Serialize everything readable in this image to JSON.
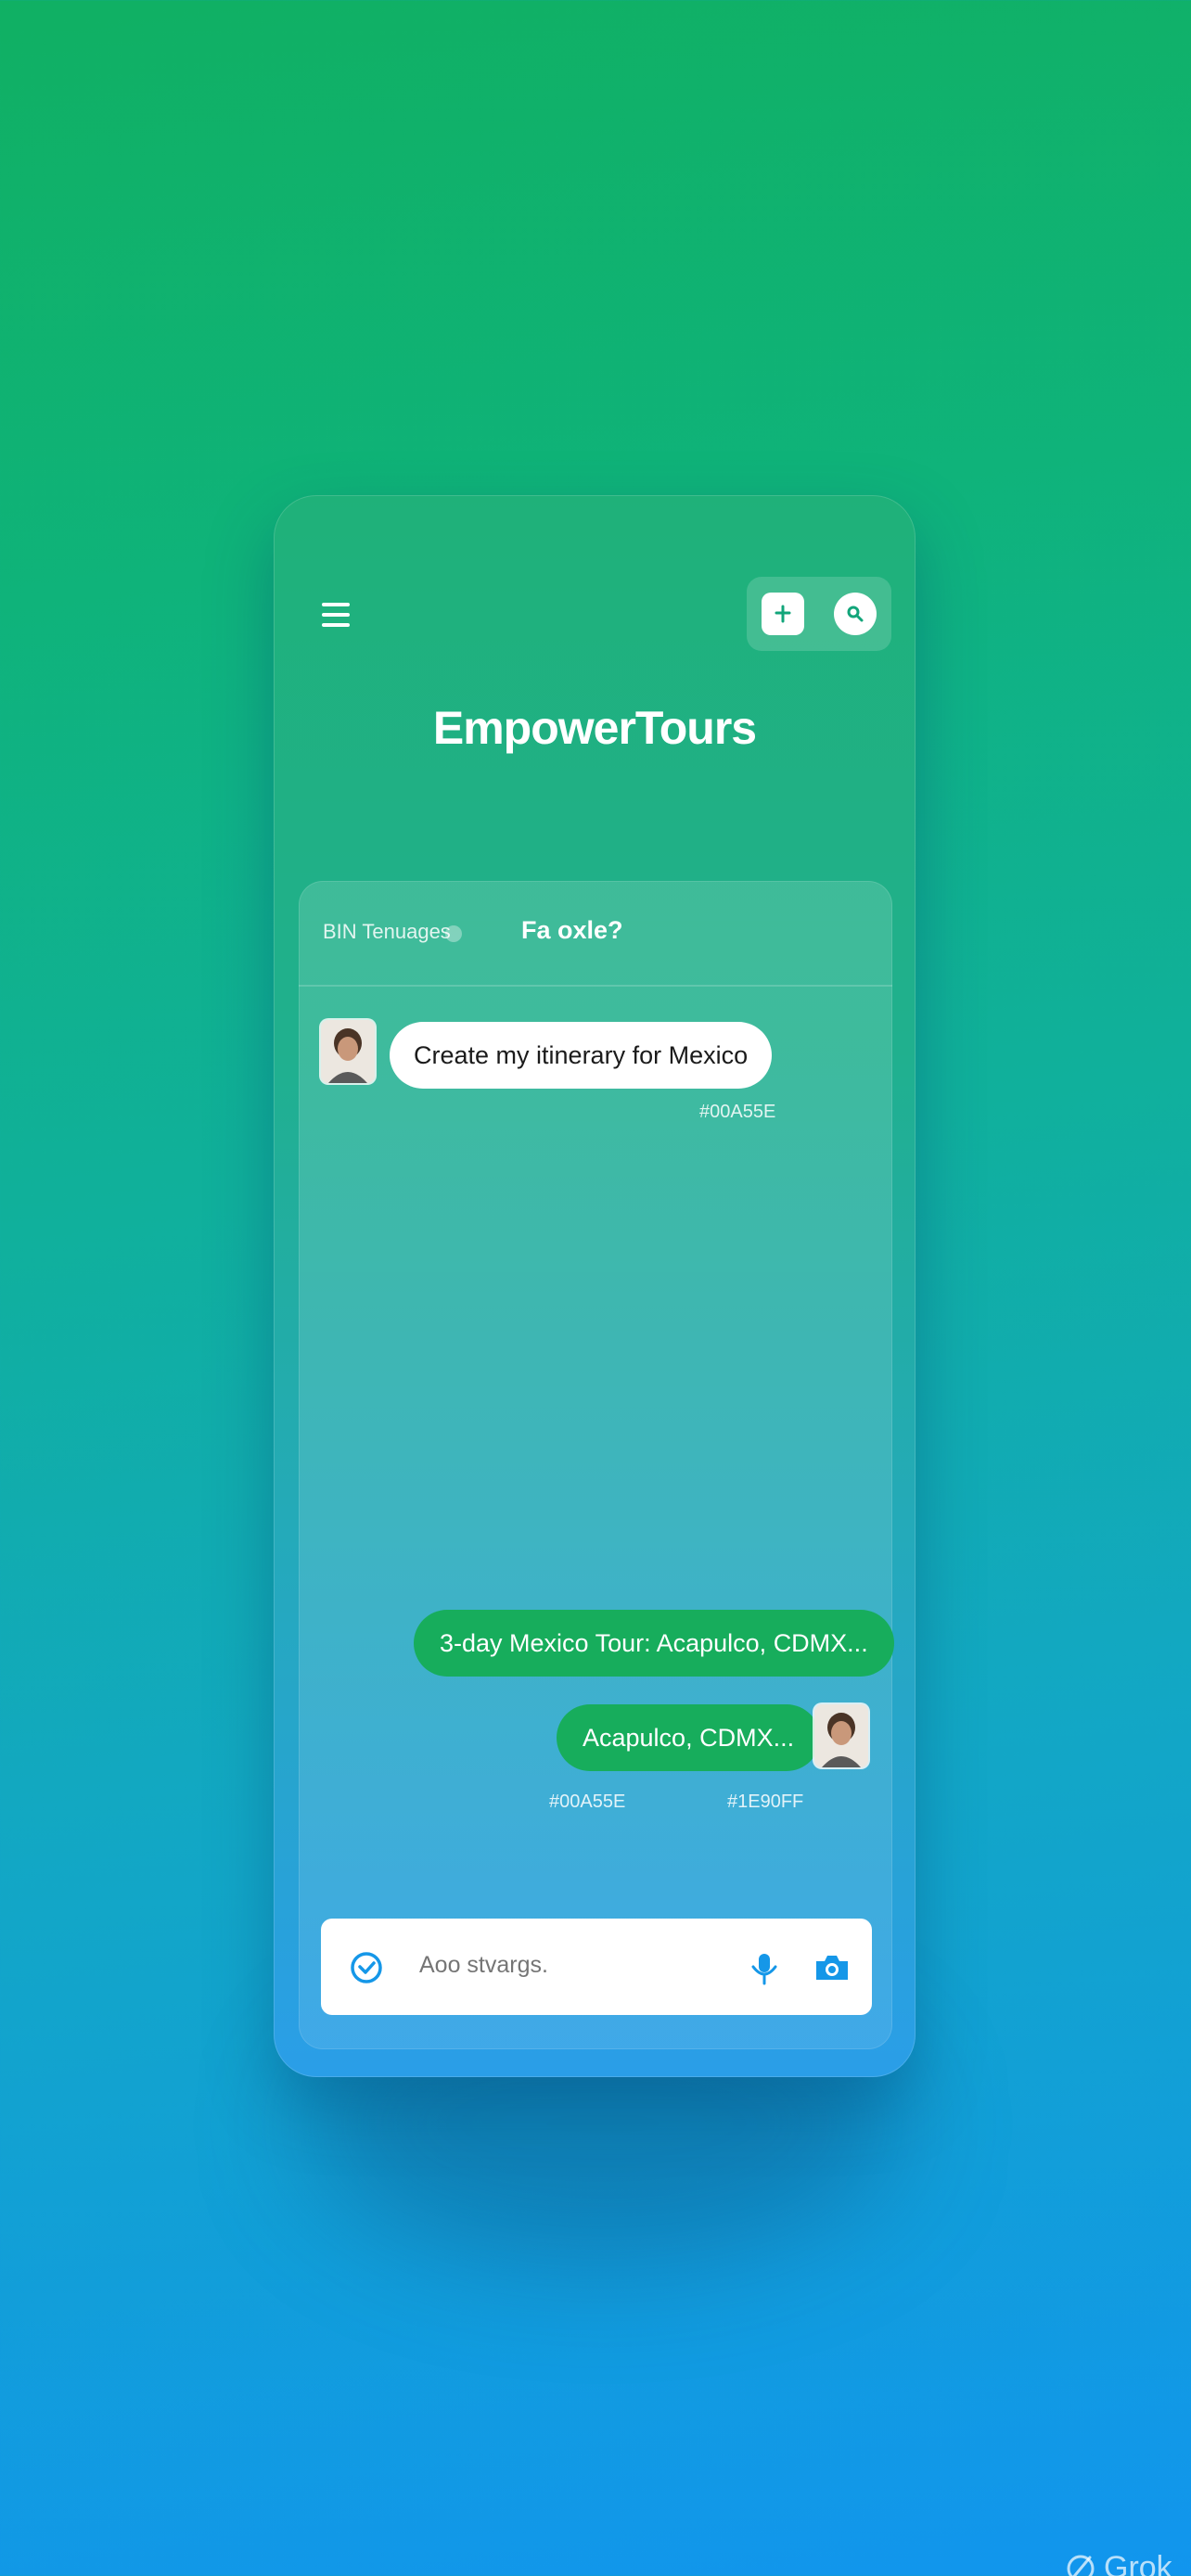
{
  "app": {
    "logo_text": "EmpowerTours"
  },
  "header_actions": {
    "menu_icon": "hamburger-icon",
    "add_icon": "plus-icon",
    "search_icon": "search-icon"
  },
  "chat": {
    "header_left": "BIN Tenuages",
    "header_title": "Fa oxle?",
    "messages": [
      {
        "sender": "user",
        "text": "Create my itinerary for Mexico",
        "color_label": "#00A55E"
      },
      {
        "sender": "bot",
        "text": "3-day Mexico Tour: Acapulco, CDMX..."
      },
      {
        "sender": "bot",
        "text": "Acapulco, CDMX...",
        "color_labels": [
          "#00A55E",
          "#1E90FF"
        ]
      }
    ]
  },
  "input": {
    "placeholder": "Aoo stvargs.",
    "left_icon": "check-circle-icon",
    "mic_icon": "mic-icon",
    "camera_icon": "camera-icon"
  },
  "colors": {
    "primary_green": "#00A55E",
    "primary_blue": "#1E90FF"
  },
  "watermark": {
    "text": "Grok"
  }
}
